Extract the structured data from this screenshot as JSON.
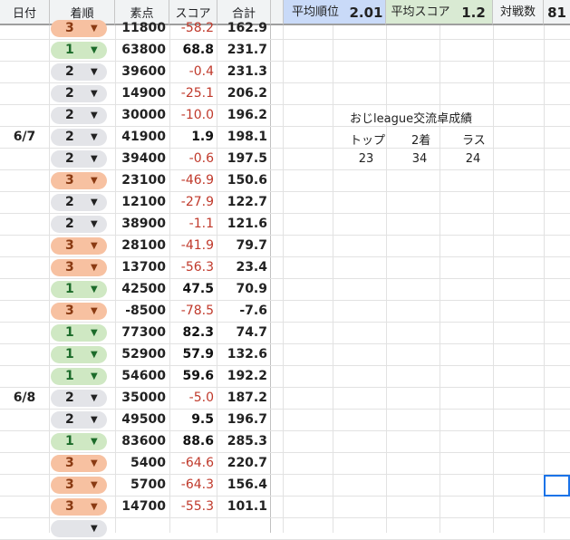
{
  "headers": {
    "date": "日付",
    "rank": "着順",
    "raw": "素点",
    "score": "スコア",
    "total": "合計"
  },
  "stats": {
    "avg_rank_label": "平均順位",
    "avg_rank_value": "2.01",
    "avg_score_label": "平均スコア",
    "avg_score_value": "1.2",
    "matches_label": "対戦数",
    "matches_value": "81"
  },
  "summary": {
    "title": "おじleague交流卓成績",
    "headers": [
      "トップ",
      "2着",
      "ラス"
    ],
    "values": [
      "23",
      "34",
      "24"
    ]
  },
  "rows": [
    {
      "date": "",
      "rank": "3",
      "raw": "11800",
      "score": "-58.2",
      "total": "162.9"
    },
    {
      "date": "",
      "rank": "1",
      "raw": "63800",
      "score": "68.8",
      "total": "231.7"
    },
    {
      "date": "",
      "rank": "2",
      "raw": "39600",
      "score": "-0.4",
      "total": "231.3"
    },
    {
      "date": "",
      "rank": "2",
      "raw": "14900",
      "score": "-25.1",
      "total": "206.2"
    },
    {
      "date": "",
      "rank": "2",
      "raw": "30000",
      "score": "-10.0",
      "total": "196.2"
    },
    {
      "date": "6/7",
      "rank": "2",
      "raw": "41900",
      "score": "1.9",
      "total": "198.1"
    },
    {
      "date": "",
      "rank": "2",
      "raw": "39400",
      "score": "-0.6",
      "total": "197.5"
    },
    {
      "date": "",
      "rank": "3",
      "raw": "23100",
      "score": "-46.9",
      "total": "150.6"
    },
    {
      "date": "",
      "rank": "2",
      "raw": "12100",
      "score": "-27.9",
      "total": "122.7"
    },
    {
      "date": "",
      "rank": "2",
      "raw": "38900",
      "score": "-1.1",
      "total": "121.6"
    },
    {
      "date": "",
      "rank": "3",
      "raw": "28100",
      "score": "-41.9",
      "total": "79.7"
    },
    {
      "date": "",
      "rank": "3",
      "raw": "13700",
      "score": "-56.3",
      "total": "23.4"
    },
    {
      "date": "",
      "rank": "1",
      "raw": "42500",
      "score": "47.5",
      "total": "70.9"
    },
    {
      "date": "",
      "rank": "3",
      "raw": "-8500",
      "score": "-78.5",
      "total": "-7.6"
    },
    {
      "date": "",
      "rank": "1",
      "raw": "77300",
      "score": "82.3",
      "total": "74.7"
    },
    {
      "date": "",
      "rank": "1",
      "raw": "52900",
      "score": "57.9",
      "total": "132.6"
    },
    {
      "date": "",
      "rank": "1",
      "raw": "54600",
      "score": "59.6",
      "total": "192.2"
    },
    {
      "date": "6/8",
      "rank": "2",
      "raw": "35000",
      "score": "-5.0",
      "total": "187.2"
    },
    {
      "date": "",
      "rank": "2",
      "raw": "49500",
      "score": "9.5",
      "total": "196.7"
    },
    {
      "date": "",
      "rank": "1",
      "raw": "83600",
      "score": "88.6",
      "total": "285.3"
    },
    {
      "date": "",
      "rank": "3",
      "raw": "5400",
      "score": "-64.6",
      "total": "220.7"
    },
    {
      "date": "",
      "rank": "3",
      "raw": "5700",
      "score": "-64.3",
      "total": "156.4"
    },
    {
      "date": "",
      "rank": "3",
      "raw": "14700",
      "score": "-55.3",
      "total": "101.1"
    },
    {
      "date": "",
      "rank": "",
      "raw": "",
      "score": "",
      "total": ""
    }
  ],
  "colors": {
    "rank1": "#cfe8c3",
    "rank2": "#e3e4e8",
    "rank3": "#f7c1a1",
    "negative": "#c0392b",
    "selection": "#1a73e8"
  },
  "icons": {
    "dropdown": "dropdown-arrow-icon"
  }
}
